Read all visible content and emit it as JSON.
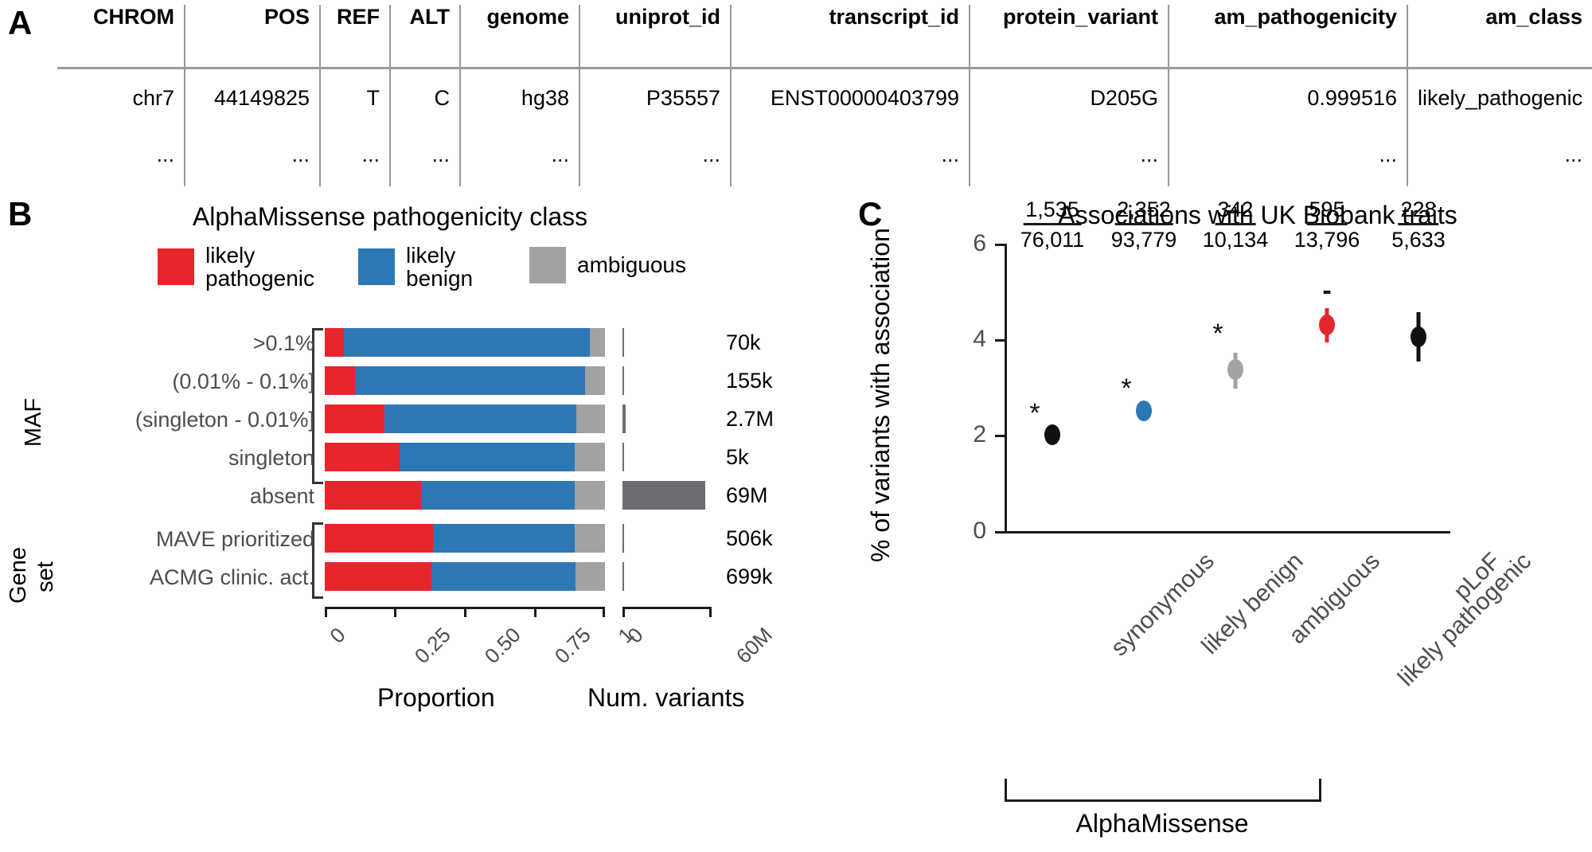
{
  "panels": {
    "a_letter": "A",
    "b_letter": "B",
    "c_letter": "C"
  },
  "table": {
    "columns": [
      "CHROM",
      "POS",
      "REF",
      "ALT",
      "genome",
      "uniprot_id",
      "transcript_id",
      "protein_variant",
      "am_pathogenicity",
      "am_class"
    ],
    "rows": [
      [
        "chr7",
        "44149825",
        "T",
        "C",
        "hg38",
        "P35557",
        "ENST00000403799",
        "D205G",
        "0.999516",
        "likely_pathogenic"
      ],
      [
        "...",
        "...",
        "...",
        "...",
        "...",
        "...",
        "...",
        "...",
        "...",
        "..."
      ]
    ]
  },
  "panelB": {
    "title": "AlphaMissense pathogenicity class",
    "legend": [
      {
        "label_line1": "likely",
        "label_line2": "pathogenic",
        "color": "#E5262C"
      },
      {
        "label_line1": "likely",
        "label_line2": "benign",
        "color": "#2E77B5"
      },
      {
        "label_line1": "ambiguous",
        "label_line2": "",
        "color": "#A2A2A2"
      }
    ],
    "group_labels": {
      "maf": "MAF",
      "gene_set_line1": "Gene",
      "gene_set_line2": "set"
    },
    "x_axis_left": {
      "title": "Proportion",
      "ticks": [
        "0",
        "0.25",
        "0.50",
        "0.75",
        "1"
      ]
    },
    "x_axis_right": {
      "title": "Num. variants",
      "ticks": [
        "0",
        "60M"
      ]
    },
    "chart_data": {
      "type": "bar",
      "orientation": "horizontal",
      "stacked": true,
      "title": "AlphaMissense pathogenicity class",
      "xlabel": "Proportion",
      "ylabel": "",
      "xlim": [
        0,
        1
      ],
      "grid": false,
      "legend_position": "top",
      "series": [
        {
          "name": "likely pathogenic",
          "color": "#E5262C",
          "values": [
            0.068,
            0.108,
            0.214,
            0.268,
            0.343,
            0.385,
            0.382
          ]
        },
        {
          "name": "likely benign",
          "color": "#2E77B5",
          "values": [
            0.879,
            0.82,
            0.684,
            0.625,
            0.548,
            0.508,
            0.513
          ]
        },
        {
          "name": "ambiguous",
          "color": "#A2A2A2",
          "values": [
            0.053,
            0.072,
            0.102,
            0.107,
            0.109,
            0.107,
            0.105
          ]
        }
      ],
      "categories": [
        ">0.1%",
        "(0.01% - 0.1%]",
        "(singleton - 0.01%]",
        "singleton",
        "absent",
        "MAVE prioritized",
        "ACMG clinic. act."
      ],
      "category_groups": [
        {
          "name": "MAF",
          "categories": [
            ">0.1%",
            "(0.01% - 0.1%]",
            "(singleton - 0.01%]",
            "singleton",
            "absent"
          ]
        },
        {
          "name": "Gene set",
          "categories": [
            "MAVE prioritized",
            "ACMG clinic. act."
          ]
        }
      ],
      "secondary_panel": {
        "type": "bar",
        "xlabel": "Num. variants",
        "xlim": [
          0,
          60000000
        ],
        "xticks": [
          0,
          60000000
        ],
        "xticklabels": [
          "0",
          "60M"
        ],
        "color": "#6B6D70",
        "values": [
          70000,
          155000,
          2700000,
          5000,
          69000000,
          506000,
          699000
        ],
        "value_labels": [
          "70k",
          "155k",
          "2.7M",
          "5k",
          "69M",
          "506k",
          "699k"
        ]
      }
    }
  },
  "panelC": {
    "title": "Associations with UK Biobank traits",
    "ylabel": "% of variants with association",
    "group_label": "AlphaMissense",
    "chart_data": {
      "type": "scatter",
      "title": "Associations with UK Biobank traits",
      "xlabel": "",
      "ylabel": "% of variants with association",
      "ylim": [
        0,
        6
      ],
      "yticks": [
        0,
        2,
        4,
        6
      ],
      "yticklabels": [
        "0",
        "2",
        "4",
        "6"
      ],
      "grid": false,
      "categories": [
        "synonymous",
        "likely benign",
        "ambiguous",
        "likely pathogenic",
        "pLoF"
      ],
      "points": [
        {
          "category": "synonymous",
          "value": 2.02,
          "err_low": 2.0,
          "err_high": 2.05,
          "color": "#111111",
          "significance": "*",
          "numerator": "1,535",
          "denominator": "76,011"
        },
        {
          "category": "likely benign",
          "value": 2.51,
          "err_low": 2.48,
          "err_high": 2.54,
          "color": "#2E77B5",
          "significance": "*",
          "numerator": "2,352",
          "denominator": "93,779"
        },
        {
          "category": "ambiguous",
          "value": 3.37,
          "err_low": 3.03,
          "err_high": 3.72,
          "color": "#A2A2A2",
          "significance": "*",
          "numerator": "342",
          "denominator": "10,134"
        },
        {
          "category": "likely pathogenic",
          "value": 4.31,
          "err_low": 3.97,
          "err_high": 4.66,
          "color": "#E5262C",
          "significance": "-",
          "numerator": "595",
          "denominator": "13,796"
        },
        {
          "category": "pLoF",
          "value": 4.05,
          "err_low": 3.54,
          "err_high": 4.57,
          "color": "#111111",
          "significance": "",
          "numerator": "228",
          "denominator": "5,633"
        }
      ]
    }
  }
}
